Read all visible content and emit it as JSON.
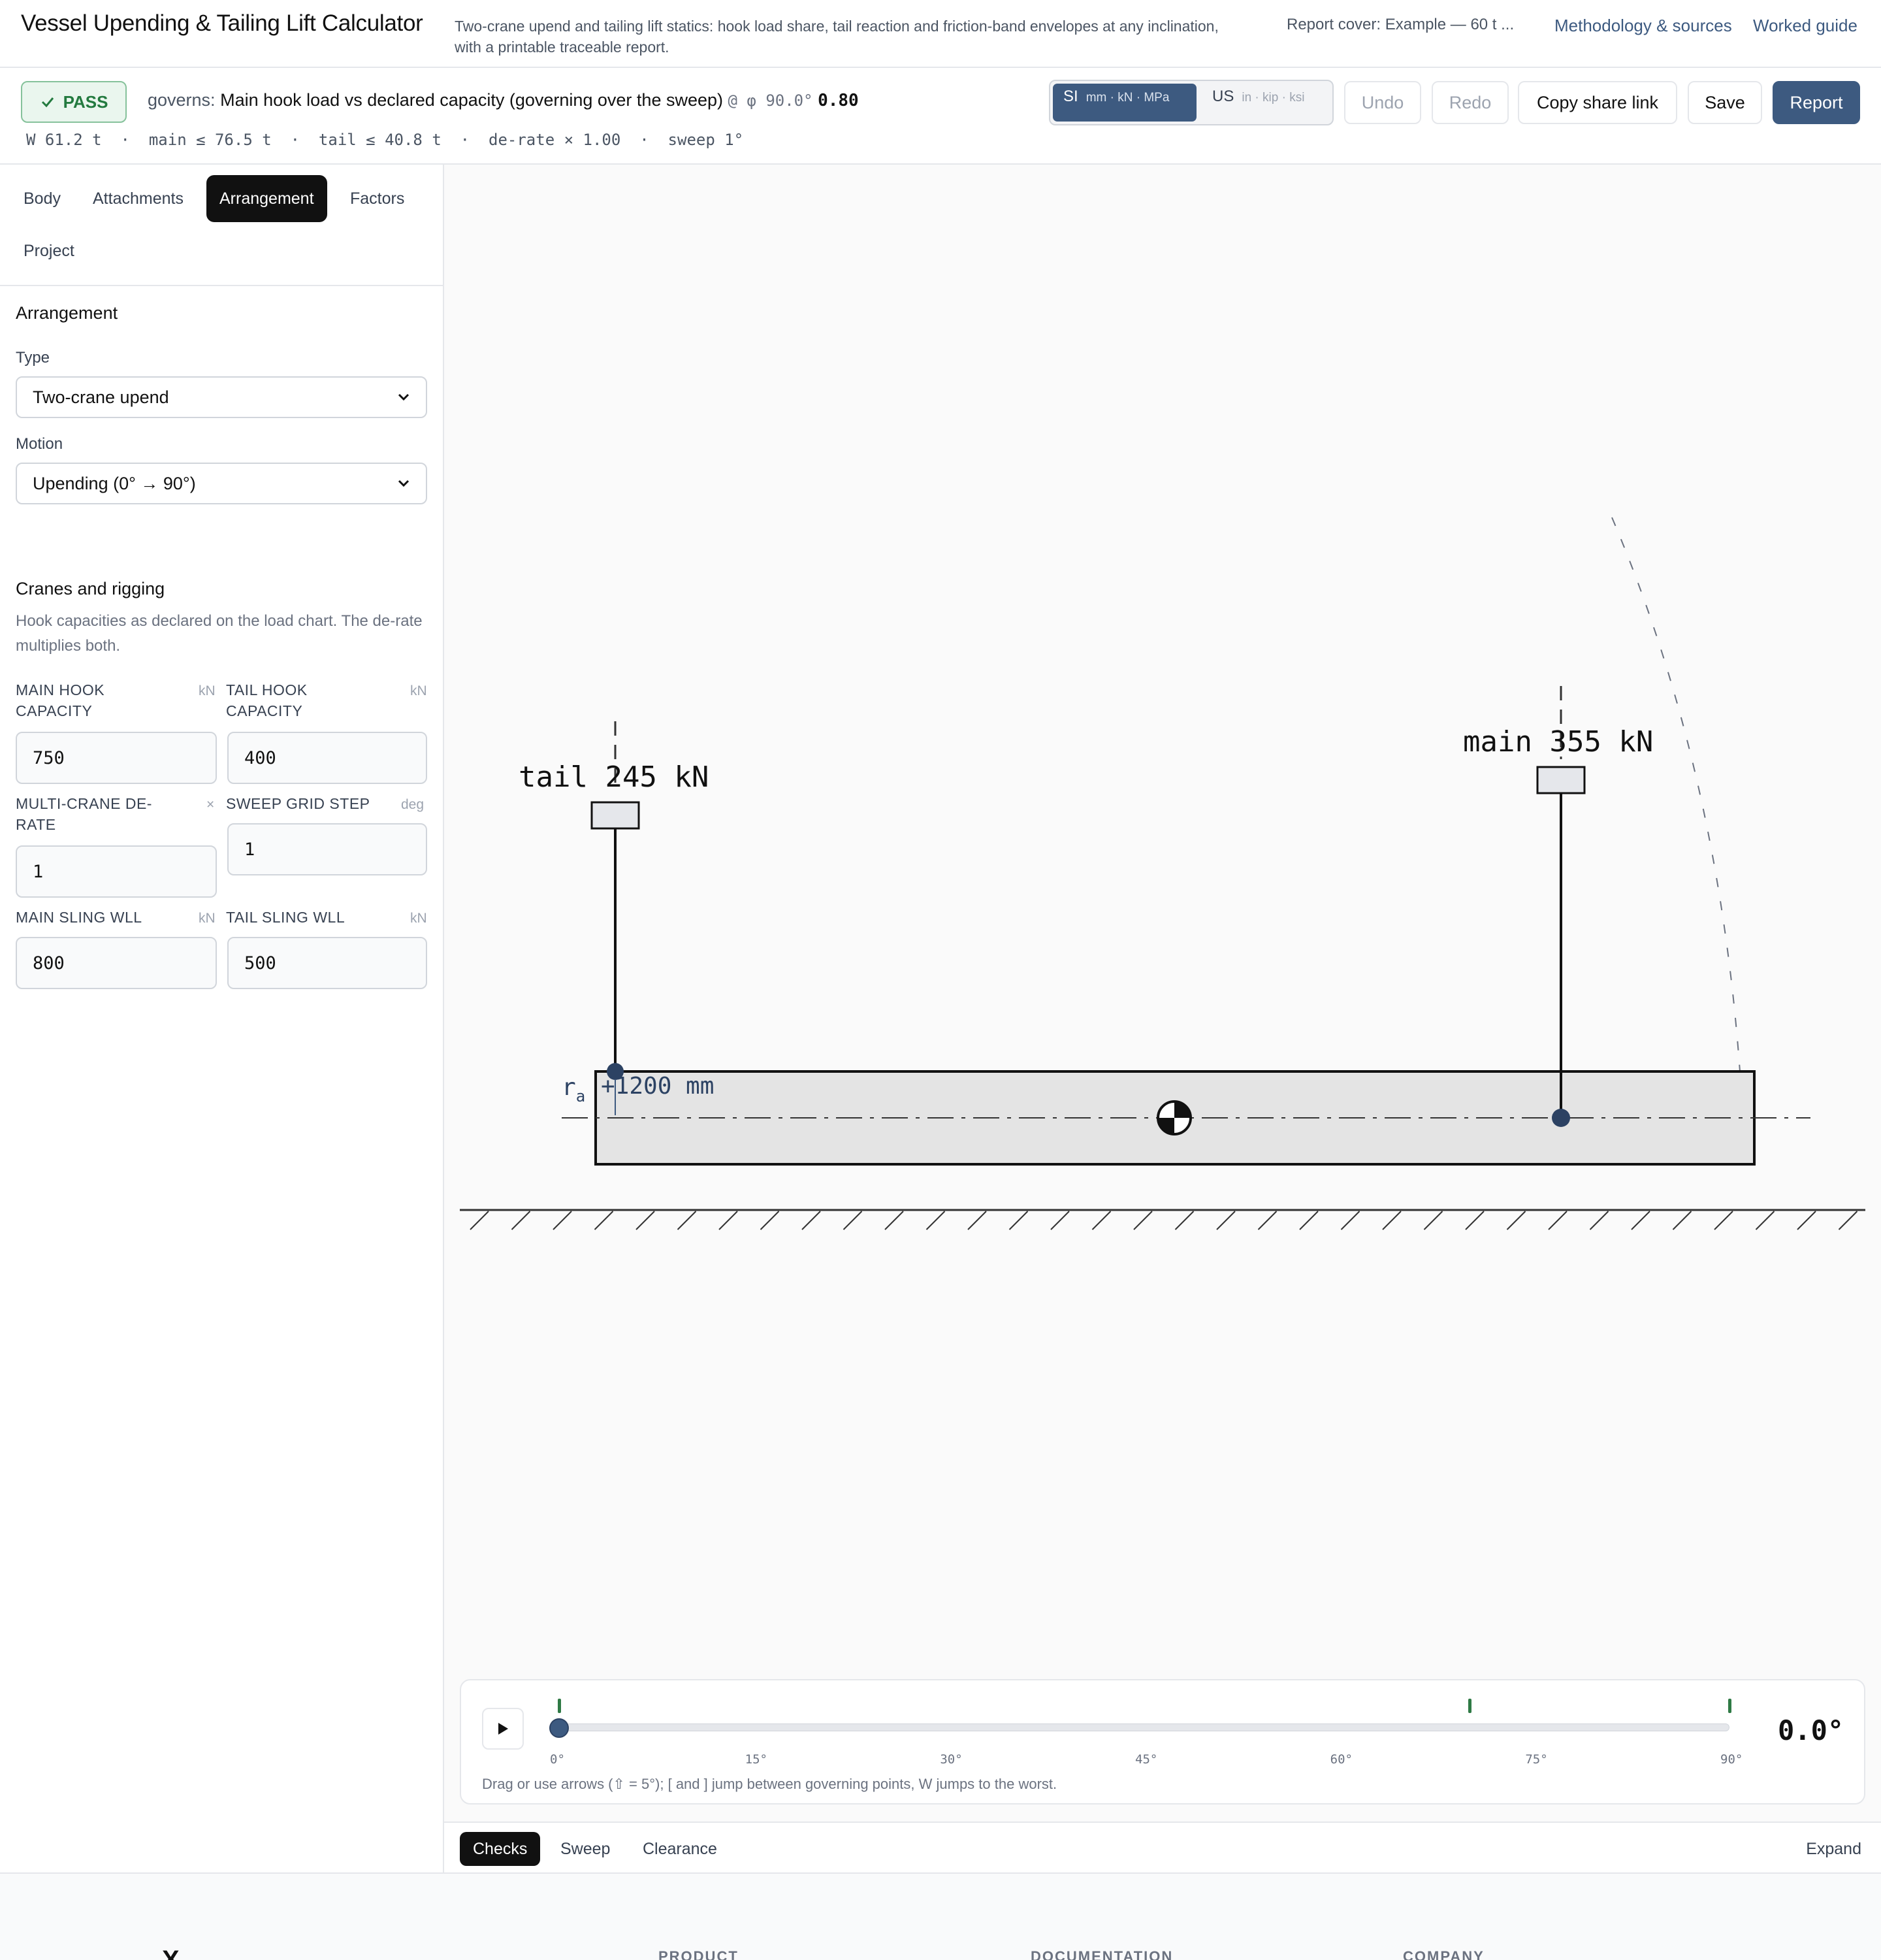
{
  "header": {
    "title": "Vessel Upending & Tailing Lift Calculator",
    "description": "Two-crane upend and tailing lift statics: hook load share, tail reaction and friction-band envelopes at any inclination, with a printable traceable report.",
    "report_cover": "Report cover: Example — 60 t ...",
    "links": [
      "Methodology & sources",
      "Worked guide"
    ]
  },
  "status": {
    "badge": "PASS",
    "governs_label": "governs:",
    "governs_text": "Main hook load vs declared capacity (governing over the sweep)",
    "at_phi": "@ φ 90.0°",
    "ratio": "0.80",
    "summary": "W 61.2 t  ·  main ≤ 76.5 t  ·  tail ≤ 40.8 t  ·  de-rate × 1.00  ·  sweep 1°"
  },
  "units": {
    "si_label": "SI",
    "si_sub": "mm · kN · MPa",
    "us_label": "US",
    "us_sub": "in · kip · ksi",
    "active": "SI"
  },
  "toolbar": {
    "undo": "Undo",
    "redo": "Redo",
    "share": "Copy share link",
    "save": "Save",
    "report": "Report"
  },
  "sidebar": {
    "tabs": [
      "Body",
      "Attachments",
      "Arrangement",
      "Factors",
      "Project"
    ],
    "active_tab": "Arrangement",
    "arrangement": {
      "title": "Arrangement",
      "type_label": "Type",
      "type_value": "Two-crane upend",
      "motion_label": "Motion",
      "motion_value": "Upending (0° → 90°)"
    },
    "cranes": {
      "title": "Cranes and rigging",
      "help": "Hook capacities as declared on the load chart. The de-rate multiplies both.",
      "fields": [
        {
          "label": "MAIN HOOK CAPACITY",
          "unit": "kN",
          "value": "750"
        },
        {
          "label": "TAIL HOOK CAPACITY",
          "unit": "kN",
          "value": "400"
        },
        {
          "label": "MULTI-CRANE DE-RATE",
          "unit": "×",
          "value": "1"
        },
        {
          "label": "SWEEP GRID STEP",
          "unit": "deg",
          "value": "1"
        },
        {
          "label": "MAIN SLING WLL",
          "unit": "kN",
          "value": "800"
        },
        {
          "label": "TAIL SLING WLL",
          "unit": "kN",
          "value": "500"
        }
      ]
    }
  },
  "diagram": {
    "tail_label": "tail 245 kN",
    "main_label": "main 355 kN",
    "ra_symbol": "r",
    "ra_sub": "a",
    "ra_value": "+1200 mm"
  },
  "sweep": {
    "angle": 0.0,
    "angle_display": "0.0°",
    "range": [
      0,
      90
    ],
    "tick_labels": [
      "0°",
      "15°",
      "30°",
      "45°",
      "60°",
      "75°",
      "90°"
    ],
    "governing_marks_deg": [
      0,
      70,
      90
    ],
    "hint": "Drag or use arrows (⇧ = 5°); [ and ] jump between governing points, W jumps to the worst."
  },
  "bottom_tabs": {
    "items": [
      "Checks",
      "Sweep",
      "Clearance"
    ],
    "active": "Checks",
    "expand": "Expand"
  },
  "footer": {
    "logo": "X",
    "columns": [
      "PRODUCT",
      "DOCUMENTATION",
      "COMPANY"
    ]
  },
  "colors": {
    "accent": "#3d5a80",
    "pass_green": "#237a3f",
    "ink": "#111111"
  }
}
